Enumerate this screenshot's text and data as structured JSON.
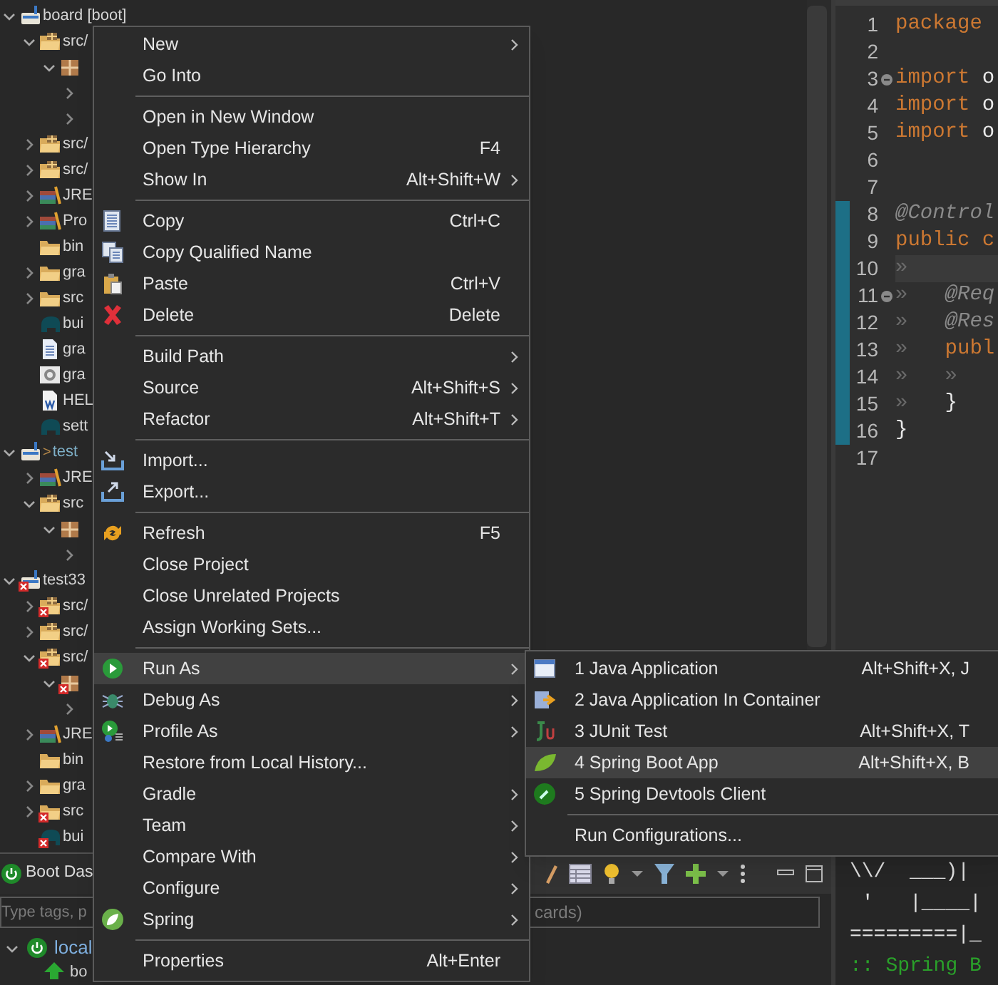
{
  "project_tree": [
    {
      "label": "board [boot]",
      "kind": "project",
      "expanded": true,
      "children": [
        {
          "label": "src/",
          "kind": "source-folder",
          "expanded": true,
          "children": [
            {
              "kind": "package",
              "expanded": true,
              "children": [
                {
                  "expanded": false
                },
                {
                  "expanded": false
                }
              ]
            }
          ]
        },
        {
          "label": "src/",
          "kind": "source-folder",
          "expanded": false
        },
        {
          "label": "src/",
          "kind": "source-folder",
          "expanded": false
        },
        {
          "label": "JRE",
          "kind": "library",
          "expanded": false
        },
        {
          "label": "Pro",
          "kind": "library",
          "expanded": false
        },
        {
          "label": "bin",
          "kind": "folder"
        },
        {
          "label": "gra",
          "kind": "folder",
          "expanded": false
        },
        {
          "label": "src",
          "kind": "folder",
          "expanded": false
        },
        {
          "label": "bui",
          "kind": "gradle"
        },
        {
          "label": "gra",
          "kind": "file"
        },
        {
          "label": "gra",
          "kind": "settings-file"
        },
        {
          "label": "HEL",
          "kind": "word"
        },
        {
          "label": "sett",
          "kind": "gradle"
        }
      ]
    },
    {
      "marker": ">",
      "label": "test",
      "kind": "project",
      "expanded": true,
      "children": [
        {
          "label": "JRE",
          "kind": "library",
          "expanded": false
        },
        {
          "label": "src",
          "kind": "source-folder",
          "expanded": true,
          "children": [
            {
              "kind": "package",
              "expanded": true,
              "children": [
                {
                  "expanded": false
                }
              ]
            }
          ]
        }
      ]
    },
    {
      "label": "test33",
      "kind": "project",
      "error": true,
      "expanded": true,
      "children": [
        {
          "label": "src/",
          "kind": "source-folder",
          "error": true,
          "expanded": false
        },
        {
          "label": "src/",
          "kind": "source-folder",
          "expanded": false
        },
        {
          "label": "src/",
          "kind": "source-folder",
          "error": true,
          "expanded": true,
          "children": [
            {
              "kind": "package",
              "error": true,
              "expanded": true,
              "children": [
                {
                  "expanded": false
                }
              ]
            }
          ]
        },
        {
          "label": "JRE",
          "kind": "library",
          "expanded": false
        },
        {
          "label": "bin",
          "kind": "folder"
        },
        {
          "label": "gra",
          "kind": "folder",
          "expanded": false
        },
        {
          "label": "src",
          "kind": "folder",
          "error": true,
          "expanded": false
        },
        {
          "label": "bui",
          "kind": "gradle",
          "error": true
        }
      ]
    }
  ],
  "editor": {
    "lines": [
      {
        "number": "1",
        "tokens": [
          {
            "kind": "keyword",
            "text": "package"
          }
        ]
      },
      {
        "number": "2"
      },
      {
        "number": "3",
        "expanded": true,
        "tokens": [
          {
            "kind": "keyword",
            "text": "import"
          },
          {
            "kind": "plain",
            "text": " o"
          }
        ]
      },
      {
        "number": "4",
        "tokens": [
          {
            "kind": "keyword",
            "text": "import"
          },
          {
            "kind": "plain",
            "text": " o"
          }
        ]
      },
      {
        "number": "5",
        "tokens": [
          {
            "kind": "keyword",
            "text": "import"
          },
          {
            "kind": "plain",
            "text": " o"
          }
        ]
      },
      {
        "number": "6"
      },
      {
        "number": "7"
      },
      {
        "number": "8",
        "changed": true,
        "tokens": [
          {
            "kind": "annotation",
            "text": "@Control"
          }
        ]
      },
      {
        "number": "9",
        "changed": true,
        "tokens": [
          {
            "kind": "keyword",
            "text": "public c"
          }
        ]
      },
      {
        "number": "10",
        "changed": true,
        "selected": true,
        "tokens": [
          {
            "kind": "tab",
            "text": "»"
          }
        ]
      },
      {
        "number": "11",
        "changed": true,
        "expanded": true,
        "tokens": [
          {
            "kind": "tab",
            "text": "»"
          },
          {
            "kind": "annotation",
            "text": "   @Req"
          }
        ]
      },
      {
        "number": "12",
        "changed": true,
        "tokens": [
          {
            "kind": "tab",
            "text": "»"
          },
          {
            "kind": "annotation",
            "text": "   @Res"
          }
        ]
      },
      {
        "number": "13",
        "changed": true,
        "tokens": [
          {
            "kind": "tab",
            "text": "»"
          },
          {
            "kind": "keyword",
            "text": "   publ"
          }
        ]
      },
      {
        "number": "14",
        "changed": true,
        "tokens": [
          {
            "kind": "tab",
            "text": "»"
          },
          {
            "kind": "tab",
            "text": "   »"
          }
        ]
      },
      {
        "number": "15",
        "changed": true,
        "tokens": [
          {
            "kind": "tab",
            "text": "»"
          },
          {
            "kind": "plain",
            "text": "   }"
          }
        ]
      },
      {
        "number": "16",
        "changed": true,
        "tokens": [
          {
            "kind": "plain",
            "text": "}"
          }
        ]
      },
      {
        "number": "17"
      }
    ]
  },
  "boot_dashboard": {
    "tab": "Boot Das",
    "filter": {
      "placeholder_start": "Type tags, p",
      "placeholder_end": "cards)"
    },
    "targets": [
      {
        "label": "local",
        "expanded": true,
        "children": [
          {
            "label": "bo"
          }
        ]
      }
    ]
  },
  "console": {
    "lines": [
      {
        "kind": "banner",
        "text": "\\\\/  ___)|"
      },
      {
        "kind": "banner",
        "text": " '   |____|"
      },
      {
        "kind": "banner",
        "text": "=========|_"
      },
      {
        "kind": "spring",
        "text": ":: Spring B"
      }
    ]
  },
  "context_menu": {
    "items": [
      {
        "kind": "item",
        "label": "New",
        "submenu": true,
        "selected": false
      },
      {
        "kind": "item",
        "label": "Go Into",
        "selected": false
      },
      {
        "kind": "separator"
      },
      {
        "kind": "item",
        "label": "Open in New Window",
        "selected": false
      },
      {
        "kind": "item",
        "label": "Open Type Hierarchy",
        "shortcut": "F4",
        "selected": false
      },
      {
        "kind": "item",
        "label": "Show In",
        "shortcut": "Alt+Shift+W",
        "submenu": true,
        "selected": false
      },
      {
        "kind": "separator"
      },
      {
        "kind": "item",
        "label": "Copy",
        "shortcut": "Ctrl+C",
        "selected": false
      },
      {
        "kind": "item",
        "label": "Copy Qualified Name",
        "selected": false
      },
      {
        "kind": "item",
        "label": "Paste",
        "shortcut": "Ctrl+V",
        "selected": false
      },
      {
        "kind": "item",
        "label": "Delete",
        "shortcut": "Delete",
        "selected": false
      },
      {
        "kind": "separator"
      },
      {
        "kind": "item",
        "label": "Build Path",
        "submenu": true,
        "selected": false
      },
      {
        "kind": "item",
        "label": "Source",
        "shortcut": "Alt+Shift+S",
        "submenu": true,
        "selected": false
      },
      {
        "kind": "item",
        "label": "Refactor",
        "shortcut": "Alt+Shift+T",
        "submenu": true,
        "selected": false
      },
      {
        "kind": "separator"
      },
      {
        "kind": "item",
        "label": "Import...",
        "selected": false
      },
      {
        "kind": "item",
        "label": "Export...",
        "selected": false
      },
      {
        "kind": "separator"
      },
      {
        "kind": "item",
        "label": "Refresh",
        "shortcut": "F5",
        "selected": false
      },
      {
        "kind": "item",
        "label": "Close Project",
        "selected": false
      },
      {
        "kind": "item",
        "label": "Close Unrelated Projects",
        "selected": false
      },
      {
        "kind": "item",
        "label": "Assign Working Sets...",
        "selected": false
      },
      {
        "kind": "separator"
      },
      {
        "kind": "item",
        "label": "Run As",
        "submenu": true,
        "selected": true
      },
      {
        "kind": "item",
        "label": "Debug As",
        "submenu": true,
        "selected": false
      },
      {
        "kind": "item",
        "label": "Profile As",
        "submenu": true,
        "selected": false
      },
      {
        "kind": "item",
        "label": "Restore from Local History...",
        "selected": false
      },
      {
        "kind": "item",
        "label": "Gradle",
        "submenu": true,
        "selected": false
      },
      {
        "kind": "item",
        "label": "Team",
        "submenu": true,
        "selected": false
      },
      {
        "kind": "item",
        "label": "Compare With",
        "submenu": true,
        "selected": false
      },
      {
        "kind": "item",
        "label": "Configure",
        "submenu": true,
        "selected": false
      },
      {
        "kind": "item",
        "label": "Spring",
        "submenu": true,
        "selected": false
      },
      {
        "kind": "separator"
      },
      {
        "kind": "item",
        "label": "Properties",
        "shortcut": "Alt+Enter",
        "selected": false
      }
    ]
  },
  "run_as_submenu": {
    "items": [
      {
        "kind": "item",
        "label": "1 Java Application",
        "shortcut": "Alt+Shift+X, J",
        "selected": false
      },
      {
        "kind": "item",
        "label": "2 Java Application In Container",
        "selected": false
      },
      {
        "kind": "item",
        "label": "3 JUnit Test",
        "shortcut": "Alt+Shift+X, T",
        "selected": false
      },
      {
        "kind": "item",
        "label": "4 Spring Boot App",
        "shortcut": "Alt+Shift+X, B",
        "selected": true
      },
      {
        "kind": "item",
        "label": "5 Spring Devtools Client",
        "selected": false
      },
      {
        "kind": "separator"
      },
      {
        "kind": "item",
        "label": "Run Configurations...",
        "selected": false
      }
    ]
  }
}
